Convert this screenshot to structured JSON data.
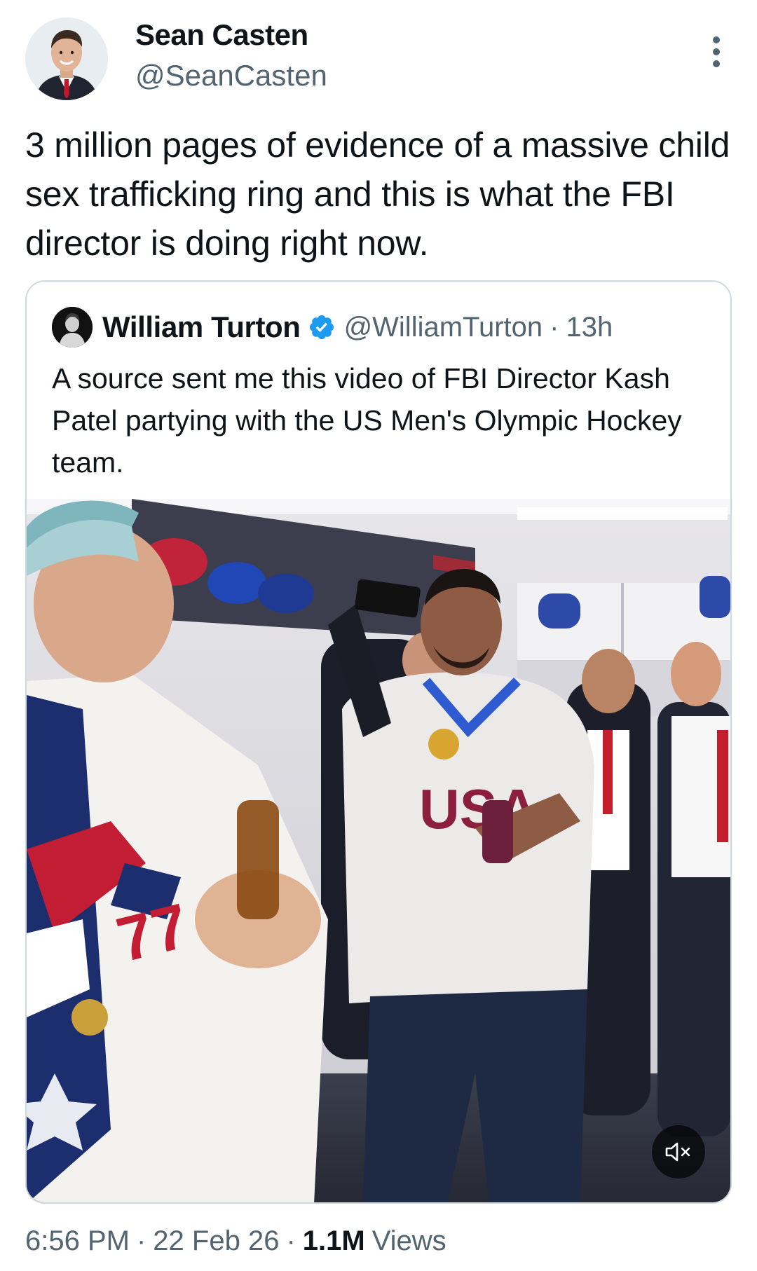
{
  "tweet": {
    "author": {
      "name": "Sean Casten",
      "handle": "@SeanCasten"
    },
    "text": "3 million pages of evidence of a massive child sex trafficking ring and this is what the FBI director is doing right now.",
    "time": "6:56 PM",
    "date": "22 Feb 26",
    "separator": "·",
    "views_count": "1.1M",
    "views_label": "Views"
  },
  "quoted": {
    "author": {
      "name": "William Turton",
      "handle": "@WilliamTurton",
      "verified": true
    },
    "separator": "·",
    "time": "13h",
    "text": "A source sent me this video of FBI Director Kash Patel partying with the US Men's Olympic Hockey team.",
    "media": {
      "type": "video",
      "muted": true,
      "scene_text": [
        "USA",
        "USA"
      ]
    }
  },
  "colors": {
    "text_primary": "#0f1419",
    "text_secondary": "#536471",
    "border": "#cfd9de",
    "verified_blue": "#1d9bf0"
  },
  "icons": [
    "more-vertical-icon",
    "verified-badge-icon",
    "mute-icon"
  ]
}
